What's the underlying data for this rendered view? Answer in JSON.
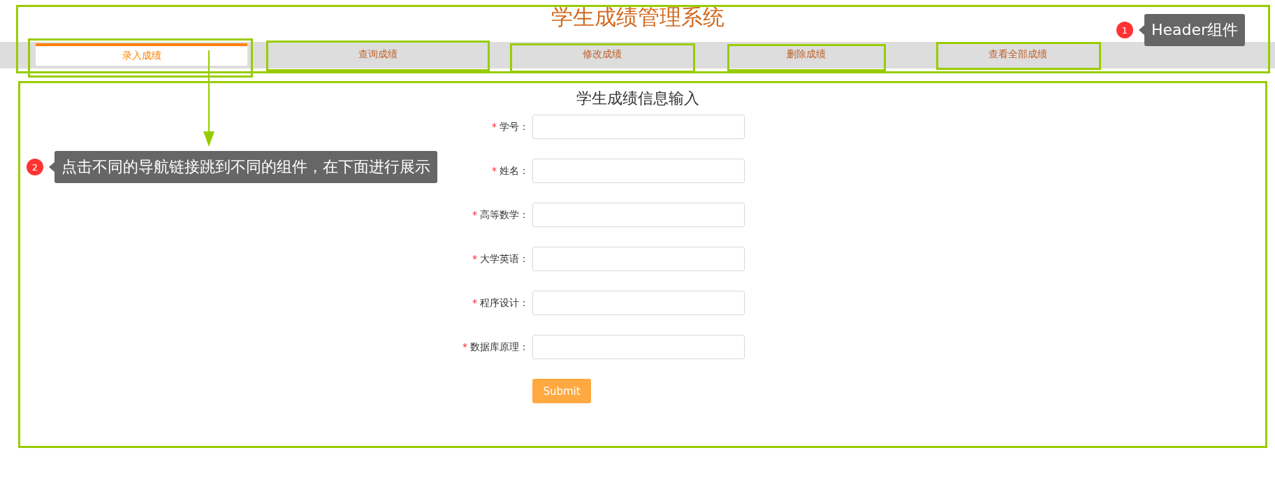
{
  "header": {
    "title": "学生成绩管理系统"
  },
  "tabs": [
    {
      "label": "录入成绩",
      "selected": true
    },
    {
      "label": "查询成绩",
      "selected": false
    },
    {
      "label": "修改成绩",
      "selected": false
    },
    {
      "label": "删除成绩",
      "selected": false
    },
    {
      "label": "查看全部成绩",
      "selected": false
    }
  ],
  "form": {
    "heading": "学生成绩信息输入",
    "fields": [
      {
        "mark": "*",
        "label": "学号："
      },
      {
        "mark": "*",
        "label": "姓名："
      },
      {
        "mark": "*",
        "label": "高等数学："
      },
      {
        "mark": "*",
        "label": "大学英语："
      },
      {
        "mark": "*",
        "label": "程序设计："
      },
      {
        "mark": "*",
        "label": "数据库原理："
      }
    ],
    "submit": "Submit"
  },
  "callouts": [
    {
      "number": "1",
      "text": "Header组件"
    },
    {
      "number": "2",
      "text": "点击不同的导航链接跳到不同的组件，在下面进行展示"
    }
  ]
}
